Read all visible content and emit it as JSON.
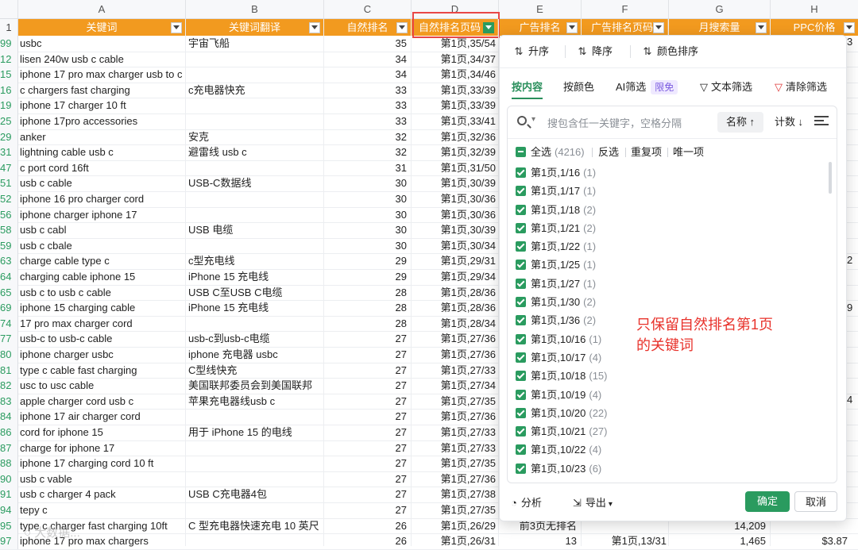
{
  "columns": [
    "A",
    "B",
    "C",
    "D",
    "E",
    "F",
    "G",
    "H"
  ],
  "header_row_num": "1",
  "headers": {
    "a": "关键词",
    "b": "关键词翻译",
    "c": "自然排名",
    "d": "自然排名页码",
    "e": "广告排名",
    "f": "广告排名页码",
    "g": "月搜索量",
    "h": "PPC价格"
  },
  "rows": [
    {
      "rn": "99",
      "a": "usbc",
      "b": "宇宙飞船",
      "c": "35",
      "d": "第1页,35/54"
    },
    {
      "rn": "12",
      "a": "lisen 240w usb c cable",
      "b": "",
      "c": "34",
      "d": "第1页,34/37"
    },
    {
      "rn": "15",
      "a": "iphone 17 pro max charger usb to c",
      "b": "",
      "c": "34",
      "d": "第1页,34/46"
    },
    {
      "rn": "16",
      "a": "c chargers fast charging",
      "b": "c充电器快充",
      "c": "33",
      "d": "第1页,33/39"
    },
    {
      "rn": "19",
      "a": "iphone 17 charger 10 ft",
      "b": "",
      "c": "33",
      "d": "第1页,33/39"
    },
    {
      "rn": "25",
      "a": "iphone 17pro accessories",
      "b": "",
      "c": "33",
      "d": "第1页,33/41"
    },
    {
      "rn": "29",
      "a": "anker",
      "b": "安克",
      "c": "32",
      "d": "第1页,32/36"
    },
    {
      "rn": "31",
      "a": "lightning cable usb c",
      "b": "避雷线 usb c",
      "c": "32",
      "d": "第1页,32/39"
    },
    {
      "rn": "47",
      "a": "c port cord 16ft",
      "b": "",
      "c": "31",
      "d": "第1页,31/50"
    },
    {
      "rn": "51",
      "a": "usb c cable",
      "b": "USB-C数据线",
      "c": "30",
      "d": "第1页,30/39"
    },
    {
      "rn": "52",
      "a": "iphone 16 pro charger cord",
      "b": "",
      "c": "30",
      "d": "第1页,30/36"
    },
    {
      "rn": "56",
      "a": "iphone charger iphone 17",
      "b": "",
      "c": "30",
      "d": "第1页,30/36"
    },
    {
      "rn": "58",
      "a": "usb c cabl",
      "b": "USB 电缆",
      "c": "30",
      "d": "第1页,30/39"
    },
    {
      "rn": "59",
      "a": "usb c cbale",
      "b": "",
      "c": "30",
      "d": "第1页,30/34"
    },
    {
      "rn": "63",
      "a": "charge cable type c",
      "b": "c型充电线",
      "c": "29",
      "d": "第1页,29/31"
    },
    {
      "rn": "64",
      "a": "charging cable iphone 15",
      "b": "iPhone 15 充电线",
      "c": "29",
      "d": "第1页,29/34"
    },
    {
      "rn": "65",
      "a": "usb c to usb c cable",
      "b": "USB C至USB C电缆",
      "c": "28",
      "d": "第1页,28/36"
    },
    {
      "rn": "69",
      "a": "iphone 15 charging cable",
      "b": "iPhone 15 充电线",
      "c": "28",
      "d": "第1页,28/36"
    },
    {
      "rn": "74",
      "a": "17 pro max charger cord",
      "b": "",
      "c": "28",
      "d": "第1页,28/34"
    },
    {
      "rn": "77",
      "a": "usb-c to usb-c cable",
      "b": "usb-c到usb-c电缆",
      "c": "27",
      "d": "第1页,27/36"
    },
    {
      "rn": "80",
      "a": "iphone charger usbc",
      "b": "iphone 充电器 usbc",
      "c": "27",
      "d": "第1页,27/36"
    },
    {
      "rn": "81",
      "a": "type c cable fast charging",
      "b": "C型线快充",
      "c": "27",
      "d": "第1页,27/33"
    },
    {
      "rn": "82",
      "a": "usc to usc cable",
      "b": "美国联邦委员会到美国联邦",
      "c": "27",
      "d": "第1页,27/34"
    },
    {
      "rn": "83",
      "a": "apple charger cord usb c",
      "b": "苹果充电器线usb c",
      "c": "27",
      "d": "第1页,27/35"
    },
    {
      "rn": "84",
      "a": "iphone 17 air charger cord",
      "b": "",
      "c": "27",
      "d": "第1页,27/36"
    },
    {
      "rn": "86",
      "a": "cord for iphone 15",
      "b": "用于 iPhone 15 的电线",
      "c": "27",
      "d": "第1页,27/33"
    },
    {
      "rn": "87",
      "a": "charge for iphone 17",
      "b": "",
      "c": "27",
      "d": "第1页,27/33"
    },
    {
      "rn": "88",
      "a": "iphone 17 charging cord 10 ft",
      "b": "",
      "c": "27",
      "d": "第1页,27/35"
    },
    {
      "rn": "90",
      "a": "usb c vable",
      "b": "",
      "c": "27",
      "d": "第1页,27/36"
    },
    {
      "rn": "91",
      "a": "usb c charger 4 pack",
      "b": "USB C充电器4包",
      "c": "27",
      "d": "第1页,27/38"
    },
    {
      "rn": "94",
      "a": "tepy c",
      "b": "",
      "c": "27",
      "d": "第1页,27/35"
    },
    {
      "rn": "95",
      "a": "type c charger fast charging 10ft",
      "b": "C 型充电器快速充电 10 英尺",
      "c": "26",
      "d": "第1页,26/29",
      "e": "前3页无排名",
      "g": "14,209"
    },
    {
      "rn": "97",
      "a": "iphone 17 pro max chargers",
      "b": "",
      "c": "26",
      "d": "第1页,26/31",
      "e": "13",
      "f": "第1页,13/31",
      "g": "1,465",
      "h": "$3.87"
    }
  ],
  "edge_chars": {
    "e": "3",
    "f": "2",
    "g": "9",
    "h": "4"
  },
  "panel": {
    "sort_asc": "升序",
    "sort_desc": "降序",
    "sort_color": "颜色排序",
    "tabs": {
      "by_content": "按内容",
      "by_color": "按颜色",
      "ai_filter": "AI筛选",
      "ai_badge": "限免",
      "text_filter": "文本筛选",
      "clear_filter": "清除筛选"
    },
    "search_placeholder": "搜包含任一关键字，空格分隔",
    "sort_by_name": "名称 ↑",
    "sort_by_count": "计数 ↓",
    "select_all": "全选",
    "select_all_count": "(4216)",
    "invert": "反选",
    "duplicates": "重复项",
    "unique": "唯一项",
    "items": [
      {
        "label": "第1页,1/16",
        "count": "(1)"
      },
      {
        "label": "第1页,1/17",
        "count": "(1)"
      },
      {
        "label": "第1页,1/18",
        "count": "(2)"
      },
      {
        "label": "第1页,1/21",
        "count": "(2)"
      },
      {
        "label": "第1页,1/22",
        "count": "(1)"
      },
      {
        "label": "第1页,1/25",
        "count": "(1)"
      },
      {
        "label": "第1页,1/27",
        "count": "(1)"
      },
      {
        "label": "第1页,1/30",
        "count": "(2)"
      },
      {
        "label": "第1页,1/36",
        "count": "(2)"
      },
      {
        "label": "第1页,10/16",
        "count": "(1)"
      },
      {
        "label": "第1页,10/17",
        "count": "(4)"
      },
      {
        "label": "第1页,10/18",
        "count": "(15)"
      },
      {
        "label": "第1页,10/19",
        "count": "(4)"
      },
      {
        "label": "第1页,10/20",
        "count": "(22)"
      },
      {
        "label": "第1页,10/21",
        "count": "(27)"
      },
      {
        "label": "第1页,10/22",
        "count": "(4)"
      },
      {
        "label": "第1页,10/23",
        "count": "(6)"
      }
    ],
    "annotation_line1": "只保留自然排名第1页",
    "annotation_line2": "的关键词",
    "analyze": "分析",
    "export": "导出",
    "confirm": "确定",
    "cancel": "取消"
  },
  "colors": {
    "header_orange": "#f29a1f",
    "accent_green": "#2a9b5f",
    "annotation_red": "#e8322b"
  }
}
